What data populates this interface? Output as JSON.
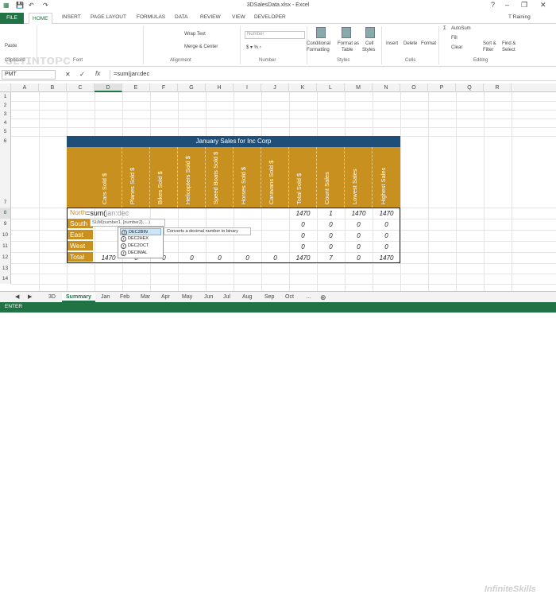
{
  "window": {
    "title": "3DSalesData.xlsx - Excel",
    "user": "T Raining"
  },
  "ribbon_tabs": [
    "FILE",
    "HOME",
    "INSERT",
    "PAGE LAYOUT",
    "FORMULAS",
    "DATA",
    "REVIEW",
    "VIEW",
    "DEVELOPER"
  ],
  "ribbon": {
    "clipboard_label": "Clipboard",
    "paste_label": "Paste",
    "font_label": "Font",
    "alignment_label": "Alignment",
    "wrap_text": "Wrap Text",
    "merge_center": "Merge & Center",
    "number_label": "Number",
    "number_format": "Number",
    "styles_label": "Styles",
    "conditional": "Conditional",
    "conditional2": "Formatting",
    "format_as": "Format as",
    "format_as2": "Table",
    "cell_styles": "Cell",
    "cell_styles2": "Styles",
    "cells_label": "Cells",
    "insert": "Insert",
    "delete": "Delete",
    "format": "Format",
    "editing_label": "Editing",
    "autosum": "AutoSum",
    "fill": "Fill",
    "clear": "Clear",
    "sort": "Sort &",
    "sort2": "Filter",
    "find": "Find &",
    "find2": "Select"
  },
  "formula_bar": {
    "name_box": "PMT",
    "fx": "fx",
    "formula": "=sum(jan:dec"
  },
  "columns": [
    "A",
    "B",
    "C",
    "D",
    "E",
    "F",
    "G",
    "H",
    "I",
    "J",
    "K",
    "L",
    "M",
    "N",
    "O",
    "P",
    "Q",
    "R"
  ],
  "rows": [
    "1",
    "2",
    "3",
    "4",
    "5",
    "6",
    "7",
    "8",
    "9",
    "10",
    "11",
    "12",
    "13",
    "14"
  ],
  "table": {
    "title": "January Sales for Inc Corp",
    "headers": [
      "Cars Sold $",
      "Planes Sold $",
      "Bikes Sold $",
      "Helicopters Sold $",
      "Speed Boats Sold $",
      "Horses Sold $",
      "Caravans Sold $",
      "Total Sold $",
      "Count Sales",
      "Lowest Sales",
      "Highest Sales"
    ],
    "row_labels": [
      "North",
      "South",
      "East",
      "West",
      "Total"
    ],
    "row8": {
      "total": "1470",
      "count": "1",
      "low": "1470",
      "high": "1470"
    },
    "row9": {
      "total": "0",
      "count": "0",
      "low": "0",
      "high": "0"
    },
    "row10": {
      "total": "0",
      "count": "0",
      "low": "0",
      "high": "0"
    },
    "row11": {
      "total": "0",
      "count": "0",
      "low": "0",
      "high": "0"
    },
    "row12": {
      "cars": "1470",
      "planes": "0",
      "bikes": "0",
      "heli": "0",
      "boats": "0",
      "horses": "0",
      "caravans": "0",
      "total": "1470",
      "count": "7",
      "low": "0",
      "high": "1470"
    }
  },
  "editing": {
    "typed": "=sum(",
    "hint": "jan:dec"
  },
  "tooltip": "SUM(number1, [number2], ...)",
  "autocomplete": {
    "items": [
      "DEC2BIN",
      "DEC2HEX",
      "DEC2OCT",
      "DECIMAL"
    ],
    "description": "Converts a decimal number to binary"
  },
  "sheet_tabs": [
    "3D",
    "Summary",
    "Jan",
    "Feb",
    "Mar",
    "Apr",
    "May",
    "Jun",
    "Jul",
    "Aug",
    "Sep",
    "Oct"
  ],
  "status": "ENTER",
  "watermark": "InfiniteSkills",
  "colors": {
    "accent": "#217346",
    "table_header": "#c8901e",
    "table_title": "#1f4e79"
  }
}
